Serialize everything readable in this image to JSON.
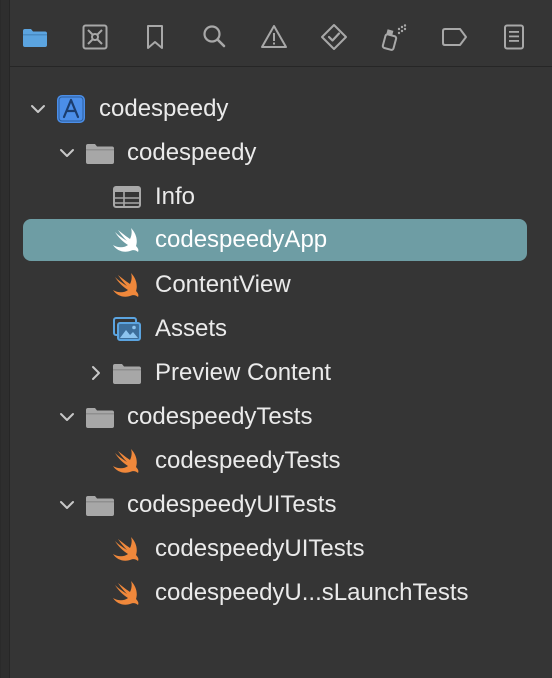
{
  "toolbar": {
    "buttons": [
      {
        "icon": "folder-icon",
        "active": true
      },
      {
        "icon": "source-control-icon",
        "active": false
      },
      {
        "icon": "bookmark-icon",
        "active": false
      },
      {
        "icon": "search-icon",
        "active": false
      },
      {
        "icon": "warning-icon",
        "active": false
      },
      {
        "icon": "test-diamond-icon",
        "active": false
      },
      {
        "icon": "debug-spray-icon",
        "active": false
      },
      {
        "icon": "breakpoint-tag-icon",
        "active": false
      },
      {
        "icon": "report-list-icon",
        "active": false
      }
    ]
  },
  "tree": {
    "project": {
      "label": "codespeedy",
      "icon": "app-project-icon"
    },
    "group_main": {
      "label": "codespeedy",
      "icon": "folder-icon"
    },
    "info": {
      "label": "Info",
      "icon": "plist-table-icon"
    },
    "app_file": {
      "label": "codespeedyApp",
      "icon": "swift-icon",
      "selected": true
    },
    "content_view": {
      "label": "ContentView",
      "icon": "swift-icon"
    },
    "assets": {
      "label": "Assets",
      "icon": "asset-catalog-icon"
    },
    "preview_content": {
      "label": "Preview Content",
      "icon": "folder-icon"
    },
    "group_tests": {
      "label": "codespeedyTests",
      "icon": "folder-icon"
    },
    "tests_file": {
      "label": "codespeedyTests",
      "icon": "swift-icon"
    },
    "group_uitests": {
      "label": "codespeedyUITests",
      "icon": "folder-icon"
    },
    "uitests_file": {
      "label": "codespeedyUITests",
      "icon": "swift-icon"
    },
    "uitests_launch_file": {
      "label": "codespeedyU...sLaunchTests",
      "icon": "swift-icon"
    }
  },
  "colors": {
    "selection": "#6e9da4",
    "swift": "#f0883b",
    "active_tab": "#5ba4e0",
    "icon_gray": "#a8a8a8",
    "folder": "#a7a7a7"
  }
}
